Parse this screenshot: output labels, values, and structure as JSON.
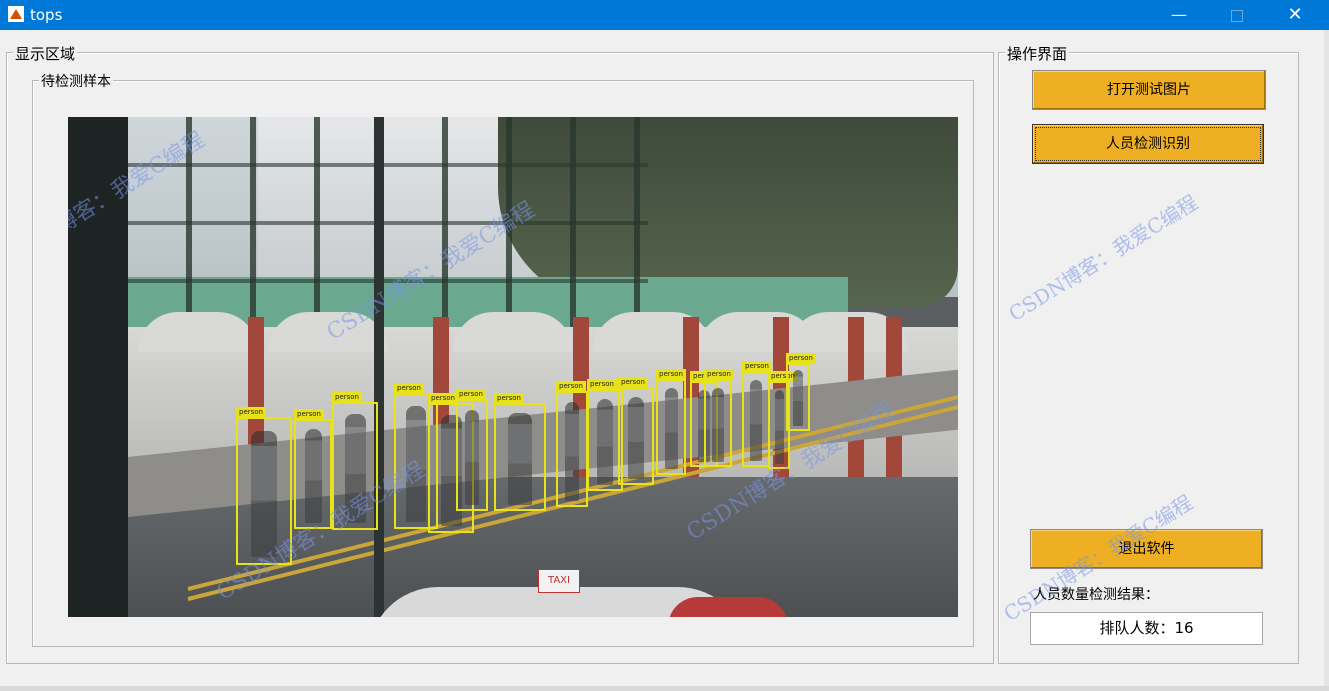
{
  "window": {
    "title": "tops",
    "minimize_glyph": "—",
    "maximize_glyph": "□",
    "close_glyph": "✕",
    "app_icon": "matlab-icon"
  },
  "display_panel": {
    "title": "显示区域",
    "sample_panel": {
      "title": "待检测样本",
      "image": {
        "description_icon": "detection-image",
        "detections": [
          {
            "label": "person"
          },
          {
            "label": "person"
          },
          {
            "label": "person"
          },
          {
            "label": "person"
          },
          {
            "label": "person"
          },
          {
            "label": "person"
          },
          {
            "label": "person"
          },
          {
            "label": "person"
          },
          {
            "label": "person"
          },
          {
            "label": "person"
          },
          {
            "label": "person"
          },
          {
            "label": "person"
          },
          {
            "label": "person"
          },
          {
            "label": "person"
          },
          {
            "label": "person"
          },
          {
            "label": "person"
          }
        ],
        "taxi_text": "TAXI",
        "watermarks": [
          "CSDN博客：我爱C编程",
          "CSDN博客：我爱C编程",
          "CSDN博客：我爱C编程",
          "CSDN博客：我爱C编程"
        ]
      }
    }
  },
  "ops_panel": {
    "title": "操作界面",
    "open_button": "打开测试图片",
    "detect_button": "人员检测识别",
    "exit_button": "退出软件",
    "result_label": "人员数量检测结果：",
    "result_value": "排队人数：16",
    "watermarks": [
      "CSDN博客：我爱C编程",
      "CSDN博客：我爱C编程"
    ]
  },
  "colors": {
    "titlebar": "#0078d7",
    "button": "#eeaf22",
    "detection_box": "#e8e21a"
  }
}
